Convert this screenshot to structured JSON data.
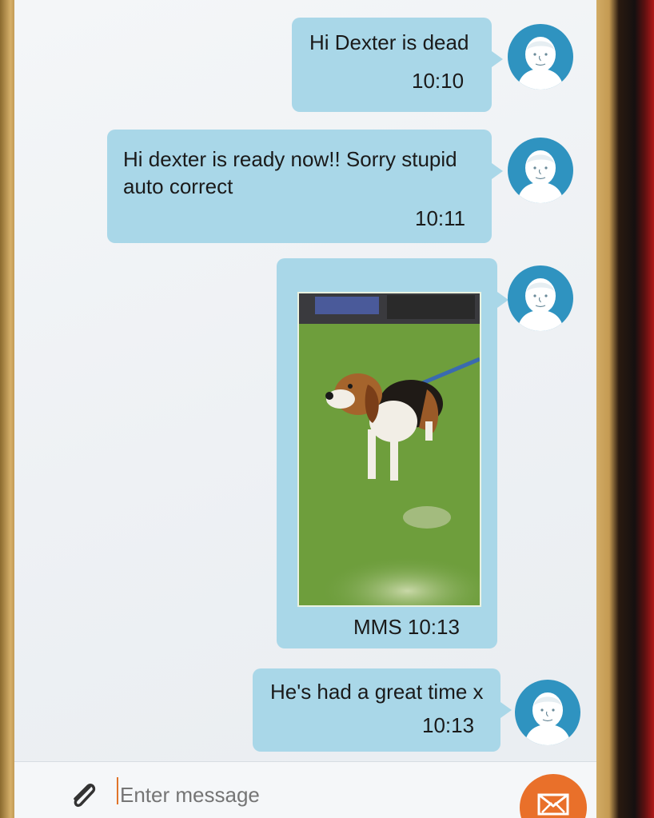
{
  "conversation": {
    "messages": [
      {
        "text": "Hi Dexter is dead",
        "time": "10:10"
      },
      {
        "text_line1": "Hi dexter is ready now!! Sorry stupid",
        "text_line2": "auto correct",
        "time": "10:11"
      },
      {
        "type": "image",
        "label": "MMS 10:13"
      },
      {
        "text": "He's had a great time x",
        "time": "10:13"
      }
    ]
  },
  "composer": {
    "placeholder": "Enter message"
  },
  "icons": {
    "attach": "paperclip-icon",
    "send": "send-mail-icon",
    "avatar": "contact-avatar-icon"
  },
  "colors": {
    "bubble": "#a9d7e8",
    "avatar": "#2f93c0",
    "send_button": "#e9702a"
  }
}
